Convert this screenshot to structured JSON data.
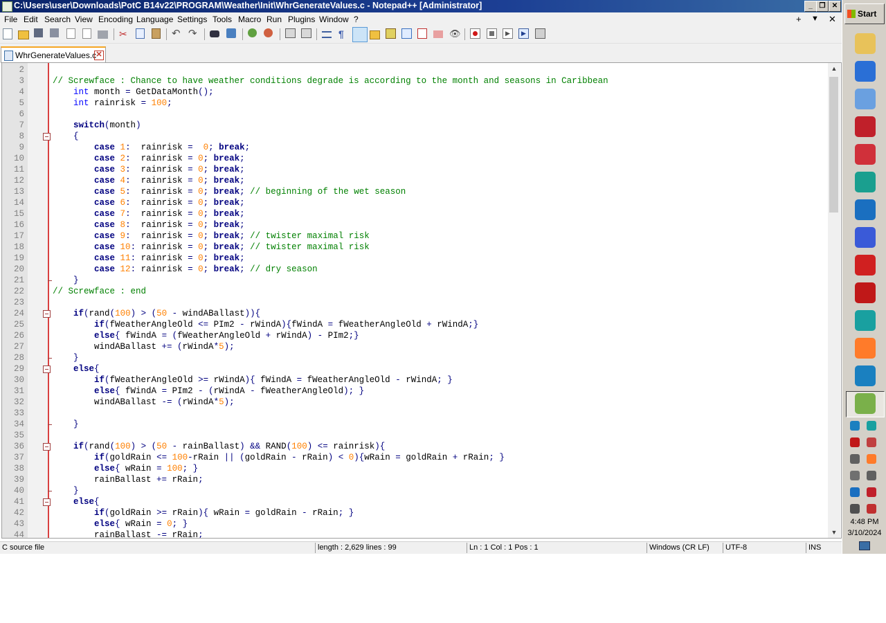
{
  "window": {
    "title": "C:\\Users\\user\\Downloads\\PotC B14v22\\PROGRAM\\Weather\\Init\\WhrGenerateValues.c - Notepad++ [Administrator]",
    "controls": {
      "minimize": "_",
      "maximize": "❐",
      "close": "✕"
    }
  },
  "menu": {
    "items": [
      "File",
      "Edit",
      "Search",
      "View",
      "Encoding",
      "Language",
      "Settings",
      "Tools",
      "Macro",
      "Run",
      "Plugins",
      "Window",
      "?"
    ],
    "right": {
      "plus": "+",
      "dropdown": "▼",
      "close": "✕"
    }
  },
  "toolbar": {
    "icons": [
      "new-file-icon",
      "open-file-icon",
      "save-icon",
      "save-all-icon",
      "close-icon",
      "close-all-icon",
      "print-icon",
      "cut-icon",
      "copy-icon",
      "paste-icon",
      "undo-icon",
      "redo-icon",
      "find-icon",
      "replace-icon",
      "zoom-in-icon",
      "zoom-out-icon",
      "sync-vertical-icon",
      "sync-horizontal-icon",
      "word-wrap-icon",
      "show-all-chars-icon",
      "indent-guide-icon",
      "udl-icon",
      "doc-map-icon",
      "doc-list-icon",
      "function-list-icon",
      "folder-workspace-icon",
      "monitor-icon",
      "record-macro-icon",
      "stop-record-icon",
      "play-macro-icon",
      "run-macro-multiple-icon",
      "save-macro-icon"
    ]
  },
  "tab": {
    "label": "WhrGenerateValues.c",
    "close": "✕"
  },
  "editor": {
    "lines": [
      {
        "n": "2",
        "code": ""
      },
      {
        "n": "3",
        "code": "// Screwface : Chance to have weather conditions degrade is according to the month and seasons in Caribbean"
      },
      {
        "n": "4",
        "code": "    int month = GetDataMonth();"
      },
      {
        "n": "5",
        "code": "    int rainrisk = 100;"
      },
      {
        "n": "6",
        "code": ""
      },
      {
        "n": "7",
        "code": "    switch(month)"
      },
      {
        "n": "8",
        "code": "    {"
      },
      {
        "n": "9",
        "code": "        case 1:  rainrisk =  0; break;"
      },
      {
        "n": "10",
        "code": "        case 2:  rainrisk = 0; break;"
      },
      {
        "n": "11",
        "code": "        case 3:  rainrisk = 0; break;"
      },
      {
        "n": "12",
        "code": "        case 4:  rainrisk = 0; break;"
      },
      {
        "n": "13",
        "code": "        case 5:  rainrisk = 0; break; // beginning of the wet season"
      },
      {
        "n": "14",
        "code": "        case 6:  rainrisk = 0; break;"
      },
      {
        "n": "15",
        "code": "        case 7:  rainrisk = 0; break;"
      },
      {
        "n": "16",
        "code": "        case 8:  rainrisk = 0; break;"
      },
      {
        "n": "17",
        "code": "        case 9:  rainrisk = 0; break; // twister maximal risk"
      },
      {
        "n": "18",
        "code": "        case 10: rainrisk = 0; break; // twister maximal risk"
      },
      {
        "n": "19",
        "code": "        case 11: rainrisk = 0; break;"
      },
      {
        "n": "20",
        "code": "        case 12: rainrisk = 0; break; // dry season"
      },
      {
        "n": "21",
        "code": "    }"
      },
      {
        "n": "22",
        "code": "// Screwface : end"
      },
      {
        "n": "23",
        "code": ""
      },
      {
        "n": "24",
        "code": "    if(rand(100) > (50 - windABallast)){"
      },
      {
        "n": "25",
        "code": "        if(fWeatherAngleOld <= PIm2 - rWindA){fWindA = fWeatherAngleOld + rWindA;}"
      },
      {
        "n": "26",
        "code": "        else{ fWindA = (fWeatherAngleOld + rWindA) - PIm2;}"
      },
      {
        "n": "27",
        "code": "        windABallast += (rWindA*5);"
      },
      {
        "n": "28",
        "code": "    }"
      },
      {
        "n": "29",
        "code": "    else{"
      },
      {
        "n": "30",
        "code": "        if(fWeatherAngleOld >= rWindA){ fWindA = fWeatherAngleOld - rWindA; }"
      },
      {
        "n": "31",
        "code": "        else{ fWindA = PIm2 - (rWindA - fWeatherAngleOld); }"
      },
      {
        "n": "32",
        "code": "        windABallast -= (rWindA*5);"
      },
      {
        "n": "33",
        "code": ""
      },
      {
        "n": "34",
        "code": "    }"
      },
      {
        "n": "35",
        "code": ""
      },
      {
        "n": "36",
        "code": "    if(rand(100) > (50 - rainBallast) && RAND(100) <= rainrisk){"
      },
      {
        "n": "37",
        "code": "        if(goldRain <= 100-rRain || (goldRain - rRain) < 0){wRain = goldRain + rRain; }"
      },
      {
        "n": "38",
        "code": "        else{ wRain = 100; }"
      },
      {
        "n": "39",
        "code": "        rainBallast += rRain;"
      },
      {
        "n": "40",
        "code": "    }"
      },
      {
        "n": "41",
        "code": "    else{"
      },
      {
        "n": "42",
        "code": "        if(goldRain >= rRain){ wRain = goldRain - rRain; }"
      },
      {
        "n": "43",
        "code": "        else{ wRain = 0; }"
      },
      {
        "n": "44",
        "code": "        rainBallast -= rRain;"
      }
    ],
    "fold_open_lines": [
      "8",
      "24",
      "29",
      "36",
      "41"
    ],
    "fold_end_lines": [
      "21",
      "28",
      "34",
      "40"
    ]
  },
  "statusbar": {
    "filetype": "C source file",
    "length": "length : 2,629    lines : 99",
    "position": "Ln : 1    Col : 1    Pos : 1",
    "eol": "Windows (CR LF)",
    "encoding": "UTF-8",
    "mode": "INS"
  },
  "taskbar": {
    "start_label": "Start",
    "pinned": [
      {
        "icon": "file-explorer-icon",
        "color": "#e8c25a"
      },
      {
        "icon": "media-player-icon",
        "color": "#2a6fd6"
      },
      {
        "icon": "paint-icon",
        "color": "#6aa0e0"
      },
      {
        "icon": "screen-recorder-icon",
        "color": "#c0202a"
      },
      {
        "icon": "video-editor-icon",
        "color": "#d0303a"
      },
      {
        "icon": "edge-browser-icon",
        "color": "#1a9f8f"
      },
      {
        "icon": "security-shield-icon",
        "color": "#1a6fc0"
      },
      {
        "icon": "p-app-icon",
        "color": "#3a5ad8"
      },
      {
        "icon": "settings-gear-icon",
        "color": "#d02020"
      },
      {
        "icon": "red-tool-icon",
        "color": "#c01818"
      },
      {
        "icon": "v-shield-icon",
        "color": "#19a0a0"
      },
      {
        "icon": "firefox-icon",
        "color": "#ff7b2a"
      },
      {
        "icon": "c-cleaner-icon",
        "color": "#1a80c0"
      },
      {
        "icon": "notepadpp-icon",
        "color": "#7ab04a"
      }
    ],
    "tray": [
      {
        "icon": "tray-c-icon",
        "color": "#1a80c0"
      },
      {
        "icon": "tray-shield-icon",
        "color": "#19a0a0"
      },
      {
        "icon": "tray-red-icon",
        "color": "#c01818"
      },
      {
        "icon": "tray-tools-icon",
        "color": "#c04040"
      },
      {
        "icon": "tray-usb-icon",
        "color": "#606060"
      },
      {
        "icon": "tray-orange-icon",
        "color": "#ff7b2a"
      },
      {
        "icon": "tray-clipboard-icon",
        "color": "#707070"
      },
      {
        "icon": "tray-volume-icon",
        "color": "#606060"
      },
      {
        "icon": "tray-security-icon",
        "color": "#1a6fc0"
      },
      {
        "icon": "tray-record-icon",
        "color": "#c0202a"
      },
      {
        "icon": "tray-network-icon",
        "color": "#505050"
      },
      {
        "icon": "tray-alert-icon",
        "color": "#c03030"
      }
    ],
    "clock_time": "4:48 PM",
    "clock_date": "3/10/2024"
  }
}
